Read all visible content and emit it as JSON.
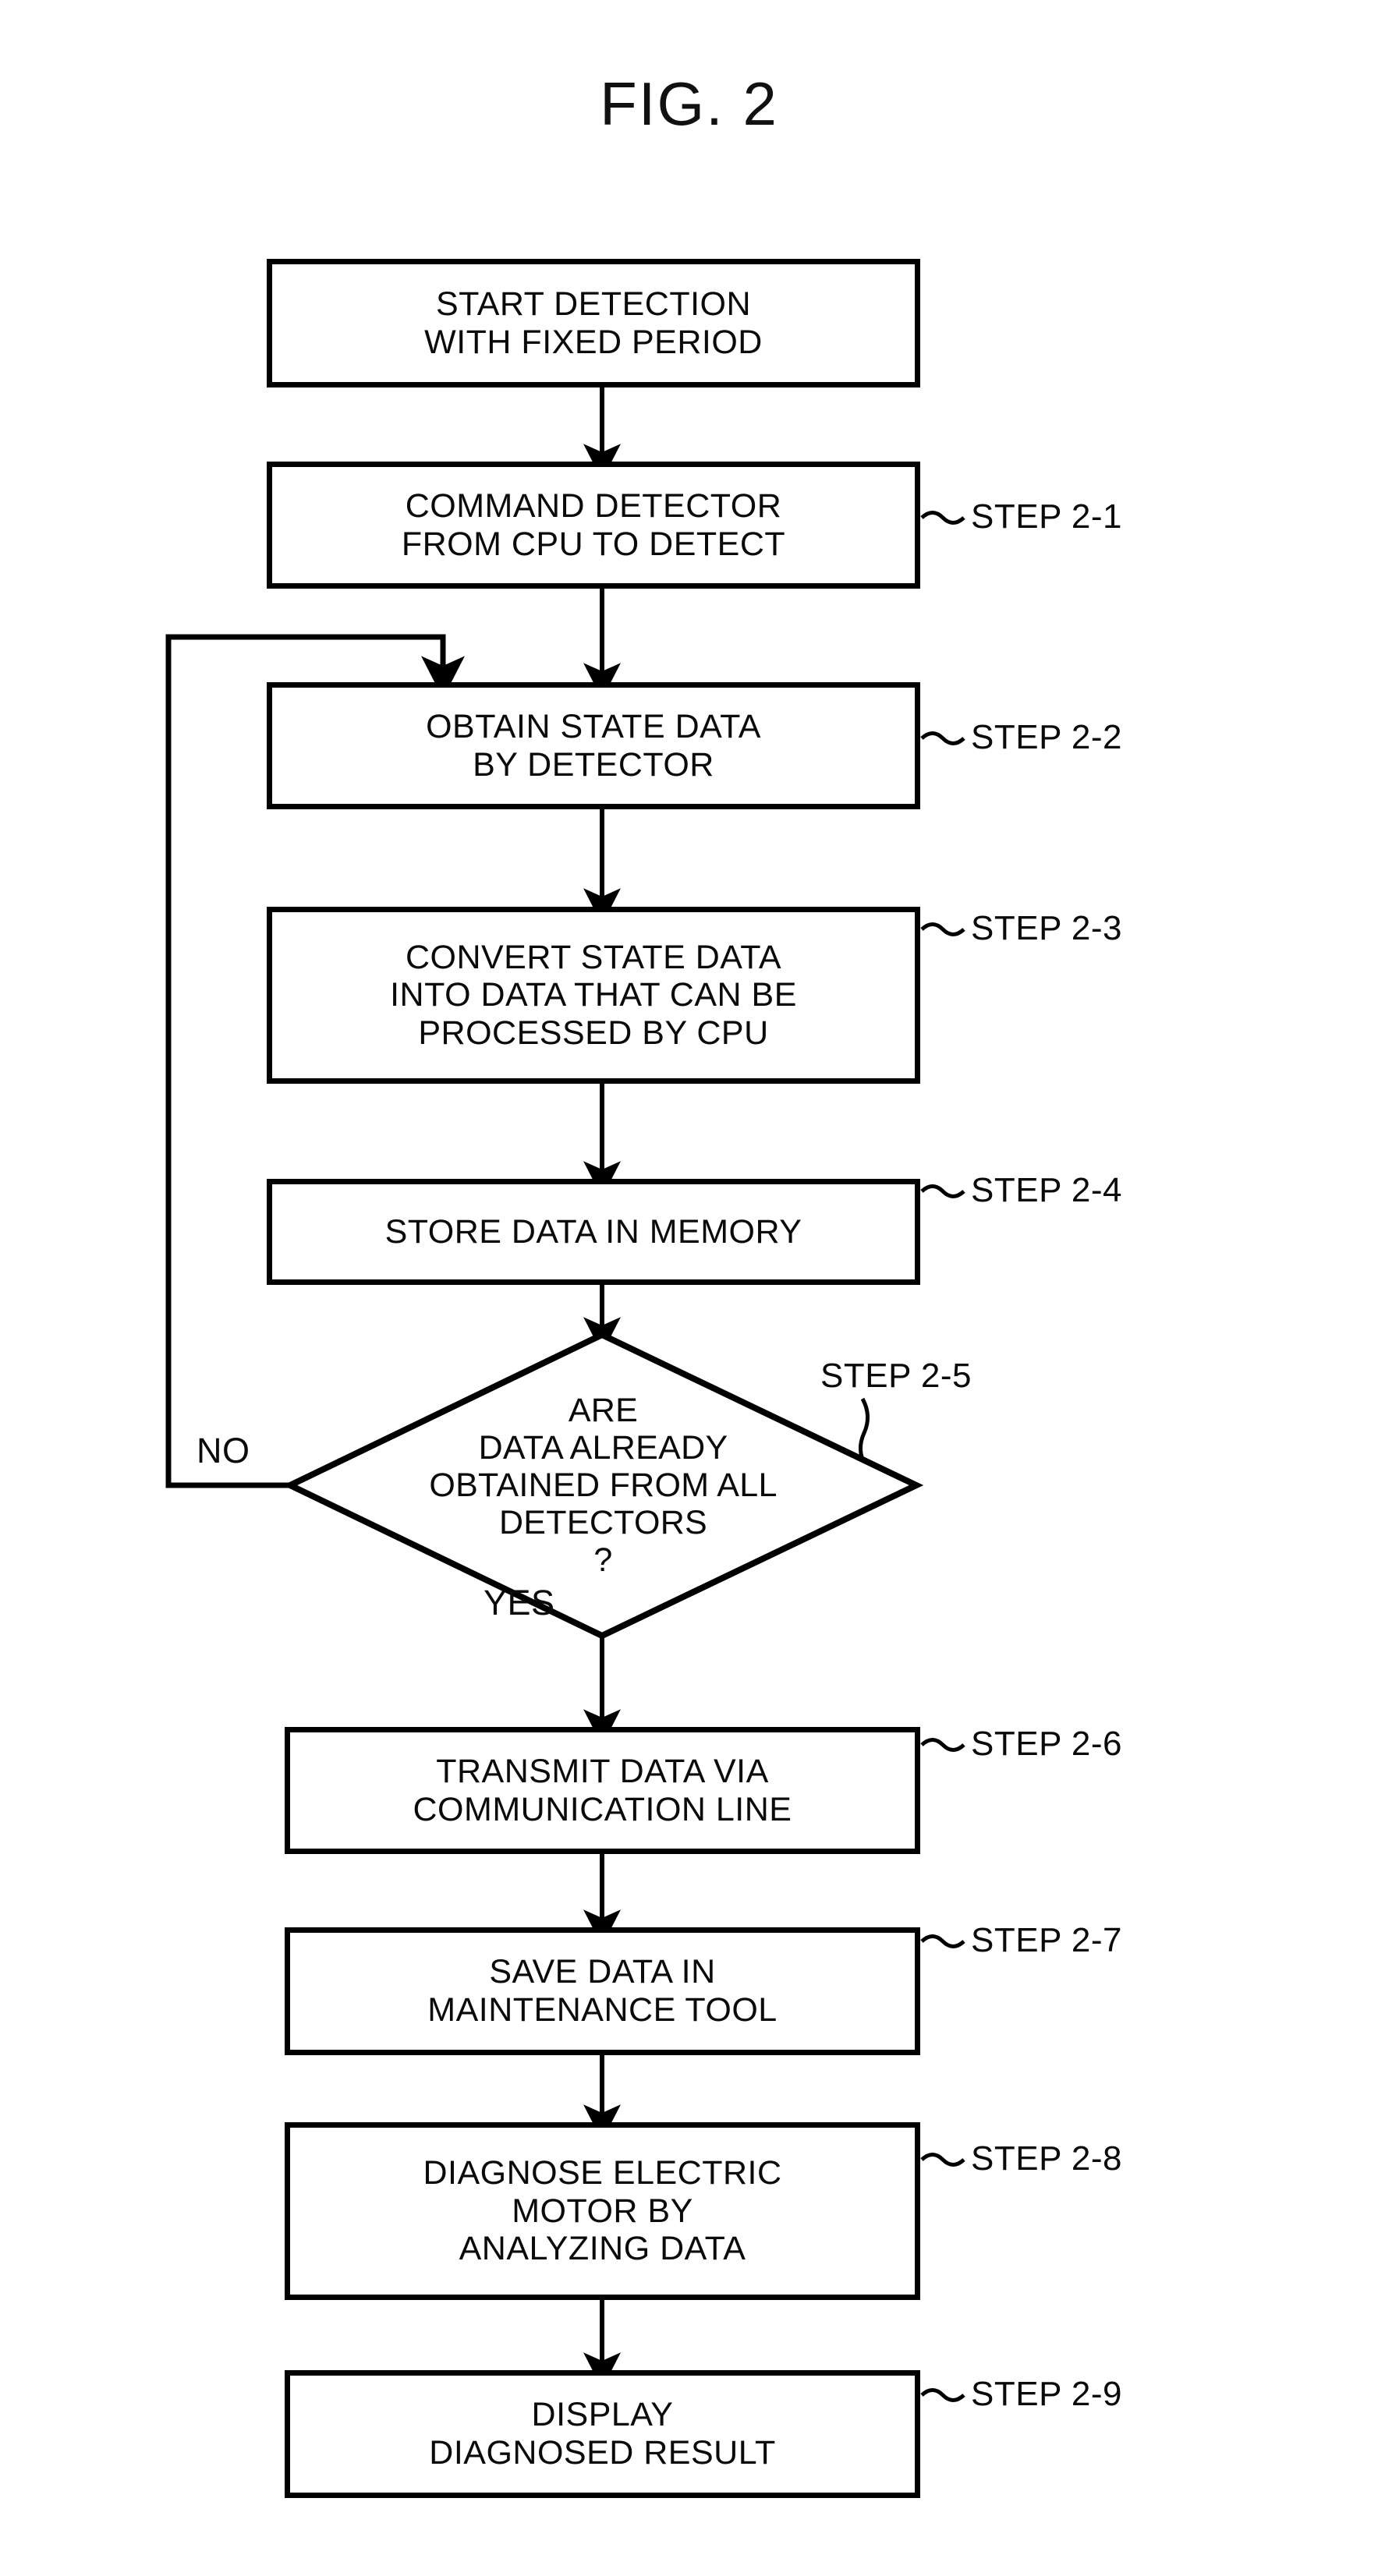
{
  "figure": {
    "title": "FIG. 2"
  },
  "flowchart": {
    "type": "flowchart",
    "orientation": "top-to-bottom",
    "nodes": [
      {
        "id": "start",
        "shape": "rectangle",
        "text": "START DETECTION\nWITH FIXED PERIOD",
        "step_label": ""
      },
      {
        "id": "step21",
        "shape": "rectangle",
        "text": "COMMAND DETECTOR\nFROM CPU TO DETECT",
        "step_label": "STEP 2-1"
      },
      {
        "id": "step22",
        "shape": "rectangle",
        "text": "OBTAIN STATE DATA\nBY DETECTOR",
        "step_label": "STEP 2-2"
      },
      {
        "id": "step23",
        "shape": "rectangle",
        "text": "CONVERT STATE DATA\nINTO DATA THAT CAN BE\nPROCESSED BY CPU",
        "step_label": "STEP 2-3"
      },
      {
        "id": "step24",
        "shape": "rectangle",
        "text": "STORE DATA IN MEMORY",
        "step_label": "STEP 2-4"
      },
      {
        "id": "step25",
        "shape": "diamond",
        "text": "ARE\nDATA ALREADY\nOBTAINED   FROM ALL\nDETECTORS\n?",
        "step_label": "STEP 2-5"
      },
      {
        "id": "step26",
        "shape": "rectangle",
        "text": "TRANSMIT DATA VIA\nCOMMUNICATION LINE",
        "step_label": "STEP 2-6"
      },
      {
        "id": "step27",
        "shape": "rectangle",
        "text": "SAVE DATA IN\nMAINTENANCE TOOL",
        "step_label": "STEP 2-7"
      },
      {
        "id": "step28",
        "shape": "rectangle",
        "text": "DIAGNOSE ELECTRIC\nMOTOR BY\nANALYZING DATA",
        "step_label": "STEP 2-8"
      },
      {
        "id": "step29",
        "shape": "rectangle",
        "text": "DISPLAY\nDIAGNOSED RESULT",
        "step_label": "STEP 2-9"
      }
    ],
    "branch_labels": {
      "no": "NO",
      "yes": "YES"
    },
    "edges": [
      {
        "from": "start",
        "to": "step21",
        "label": ""
      },
      {
        "from": "step21",
        "to": "step22",
        "label": ""
      },
      {
        "from": "step22",
        "to": "step23",
        "label": ""
      },
      {
        "from": "step23",
        "to": "step24",
        "label": ""
      },
      {
        "from": "step24",
        "to": "step25",
        "label": ""
      },
      {
        "from": "step25",
        "to": "step22",
        "label": "NO"
      },
      {
        "from": "step25",
        "to": "step26",
        "label": "YES"
      },
      {
        "from": "step26",
        "to": "step27",
        "label": ""
      },
      {
        "from": "step27",
        "to": "step28",
        "label": ""
      },
      {
        "from": "step28",
        "to": "step29",
        "label": ""
      }
    ],
    "colors": {
      "stroke": "#000000",
      "fill": "#ffffff",
      "text": "#0a0a0a"
    }
  }
}
